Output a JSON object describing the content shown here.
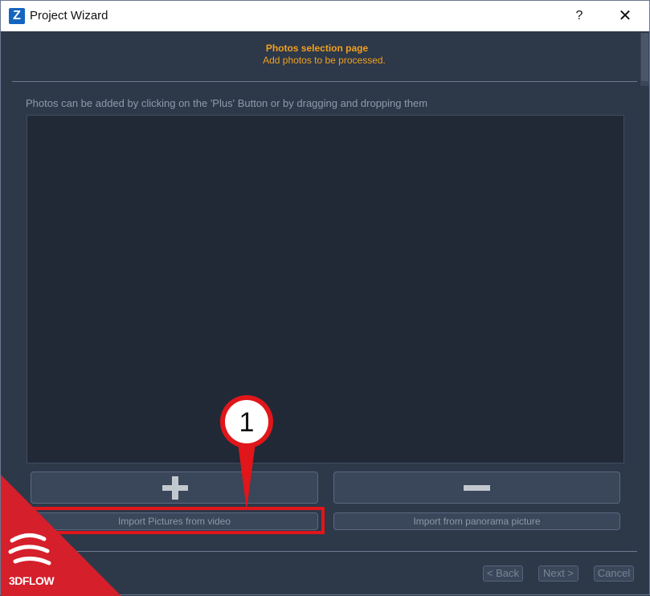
{
  "window": {
    "app_icon_letter": "Z",
    "title": "Project Wizard",
    "help_label": "?",
    "close_label": "✕"
  },
  "header": {
    "title": "Photos selection page",
    "subtitle": "Add photos to be processed."
  },
  "photos": {
    "hint": "Photos can be added by clicking on the 'Plus' Button or by dragging and dropping them"
  },
  "buttons": {
    "import_video": "Import Pictures from video",
    "import_panorama": "Import from panorama picture"
  },
  "annotation": {
    "marker_number": "1",
    "color": "#e0161a"
  },
  "nav": {
    "back": "< Back",
    "next": "Next >",
    "cancel": "Cancel"
  },
  "branding": {
    "logo_text": "3DFLOW",
    "color": "#d51f2b"
  },
  "colors": {
    "accent": "#f0a020",
    "background": "#2d3849",
    "photo_area": "#212937"
  }
}
